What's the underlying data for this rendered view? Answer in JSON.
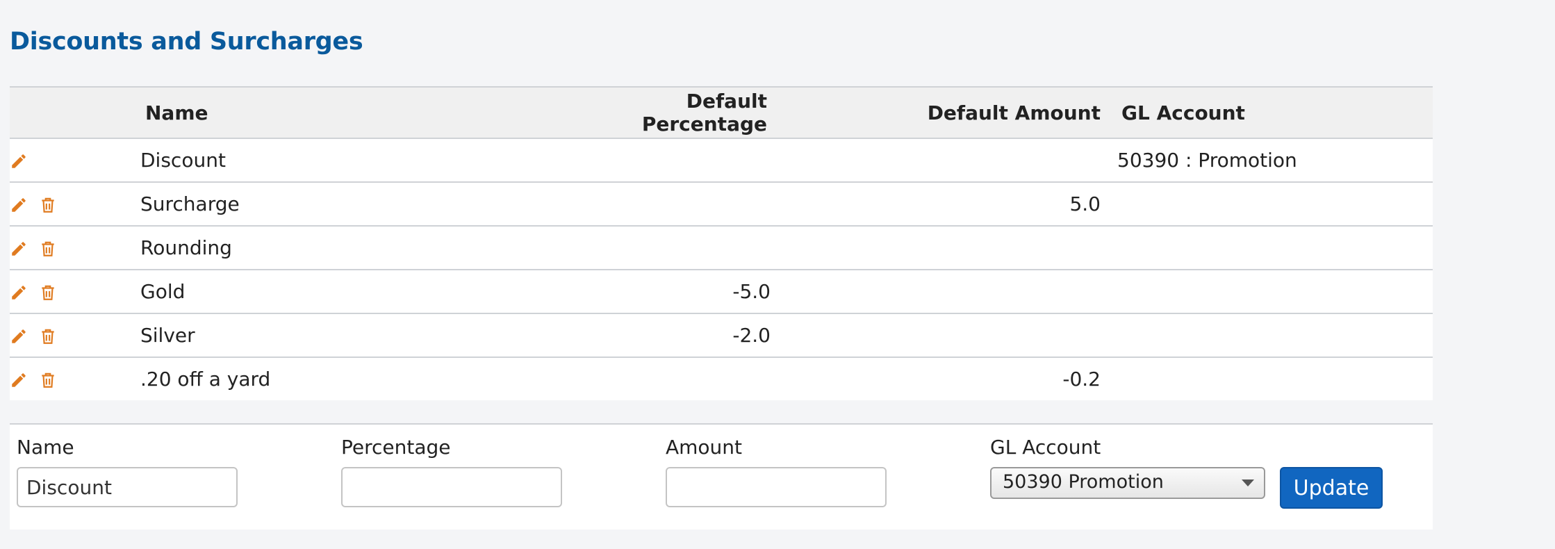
{
  "page": {
    "title": "Discounts and Surcharges"
  },
  "table": {
    "headers": {
      "name": "Name",
      "default_percentage": "Default Percentage",
      "default_amount": "Default Amount",
      "gl_account": "GL Account"
    },
    "rows": [
      {
        "name": "Discount",
        "percentage": "",
        "amount": "",
        "gl_account": "50390 : Promotion",
        "deletable": false
      },
      {
        "name": "Surcharge",
        "percentage": "",
        "amount": "5.0",
        "gl_account": "",
        "deletable": true
      },
      {
        "name": "Rounding",
        "percentage": "",
        "amount": "",
        "gl_account": "",
        "deletable": true
      },
      {
        "name": "Gold",
        "percentage": "-5.0",
        "amount": "",
        "gl_account": "",
        "deletable": true
      },
      {
        "name": "Silver",
        "percentage": "-2.0",
        "amount": "",
        "gl_account": "",
        "deletable": true
      },
      {
        "name": ".20 off a yard",
        "percentage": "",
        "amount": "-0.2",
        "gl_account": "",
        "deletable": true
      }
    ]
  },
  "icons": {
    "edit": "pencil-icon",
    "delete": "trash-icon",
    "color": "#e07b20"
  },
  "form": {
    "name_label": "Name",
    "name_value": "Discount",
    "percentage_label": "Percentage",
    "percentage_value": "",
    "amount_label": "Amount",
    "amount_value": "",
    "gl_account_label": "GL Account",
    "gl_account_selected": "50390 Promotion",
    "update_label": "Update"
  },
  "colors": {
    "title": "#0a5a9c",
    "accent_button": "#1166c0",
    "icon": "#e07b20"
  }
}
